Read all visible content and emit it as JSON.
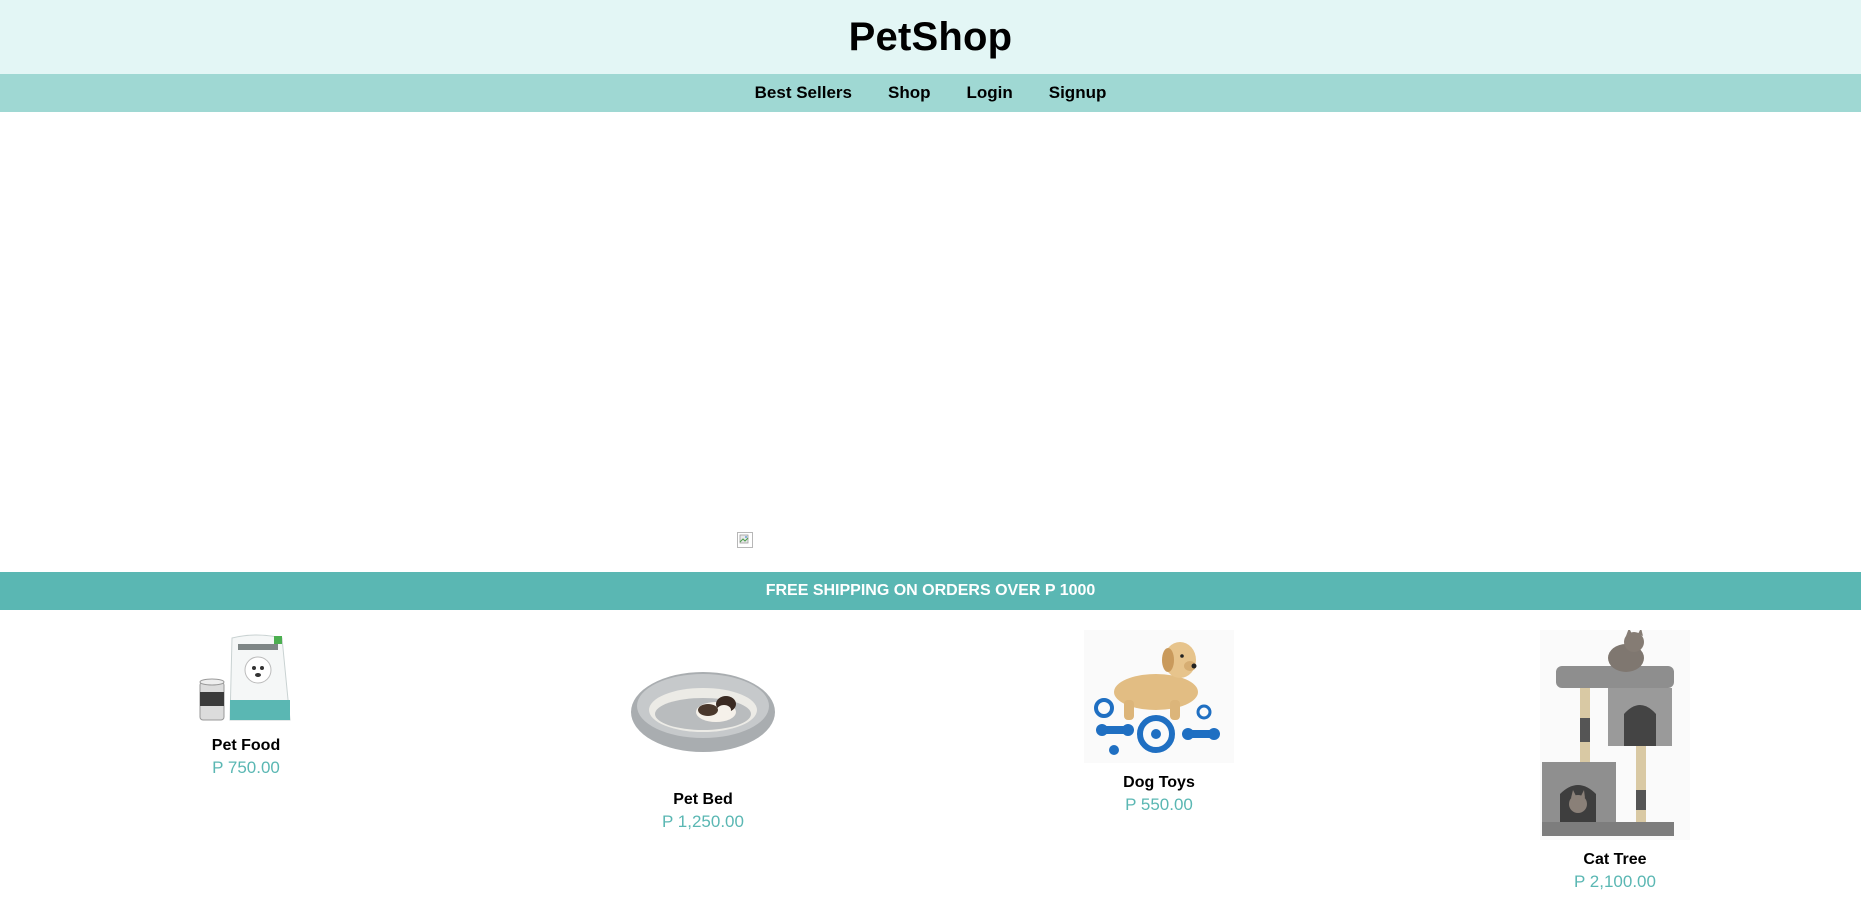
{
  "site": {
    "title": "PetShop"
  },
  "nav": {
    "items": [
      {
        "label": "Best Sellers"
      },
      {
        "label": "Shop"
      },
      {
        "label": "Login"
      },
      {
        "label": "Signup"
      }
    ]
  },
  "banner": {
    "text": "FREE SHIPPING ON ORDERS OVER P 1000"
  },
  "products": [
    {
      "name": "Pet Food",
      "price": "P 750.00",
      "image": "pet-food-bag-icon"
    },
    {
      "name": "Pet Bed",
      "price": "P 1,250.00",
      "image": "pet-bed-icon"
    },
    {
      "name": "Dog Toys",
      "price": "P 550.00",
      "image": "dog-toys-icon"
    },
    {
      "name": "Cat Tree",
      "price": "P 2,100.00",
      "image": "cat-tree-icon"
    }
  ],
  "colors": {
    "header_bg": "#e3f6f5",
    "nav_bg": "#9fd8d3",
    "banner_bg": "#5ab7b3",
    "price": "#5ab7b3"
  }
}
